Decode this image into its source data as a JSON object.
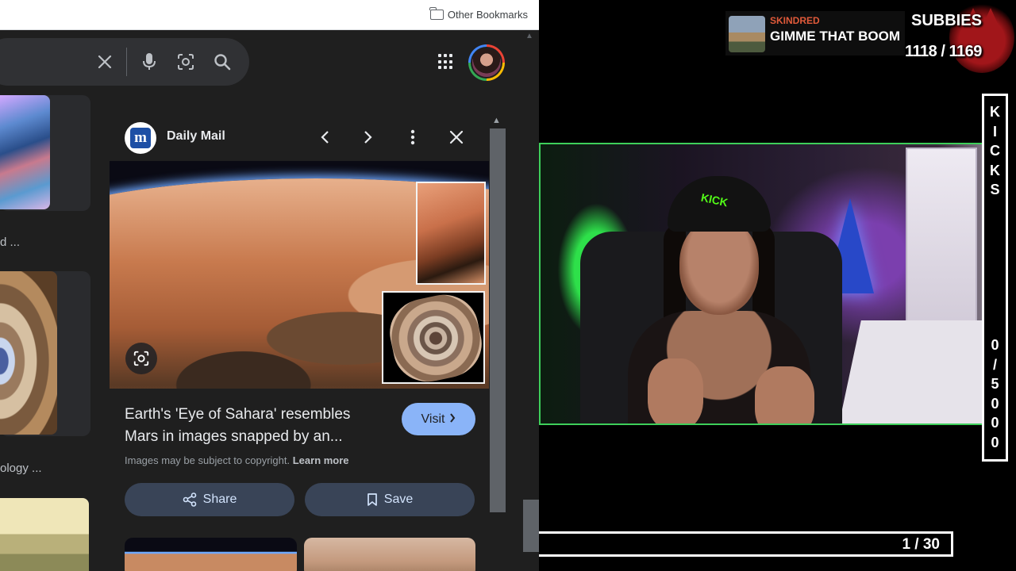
{
  "browser": {
    "bookmarks_bar": {
      "other_bookmarks_label": "Other Bookmarks"
    },
    "search": {
      "clear_icon": "close-icon",
      "voice_icon": "mic-icon",
      "lens_icon": "lens-icon",
      "search_icon": "search-icon"
    },
    "header": {
      "apps_icon": "apps-grid-icon",
      "avatar": "account-avatar"
    },
    "left_results": {
      "items": [
        {
          "caption": "d ..."
        },
        {
          "caption": "ology ..."
        }
      ]
    },
    "side_panel": {
      "source_name": "Daily Mail",
      "source_logo_letter": "m",
      "headline": "Earth's 'Eye of Sahara' resembles Mars in images snapped by an...",
      "visit_label": "Visit",
      "copyright_text": "Images may be subject to copyright.",
      "learn_more_label": "Learn more",
      "share_label": "Share",
      "save_label": "Save"
    }
  },
  "stream": {
    "alert": {
      "username": "SKINDRED",
      "message": "GIMME THAT BOOM"
    },
    "subs": {
      "label": "SUBBIES",
      "count": "1118 / 1169"
    },
    "kicks": {
      "label": [
        "K",
        "I",
        "C",
        "K",
        "S"
      ],
      "count": [
        "0",
        "/",
        "5",
        "0",
        "0",
        "0"
      ]
    },
    "progress": {
      "label": "1 / 30"
    },
    "colors": {
      "webcam_border": "#3ecf5a",
      "alert_user": "#e05a3a",
      "kick_green": "#53fc18"
    }
  }
}
